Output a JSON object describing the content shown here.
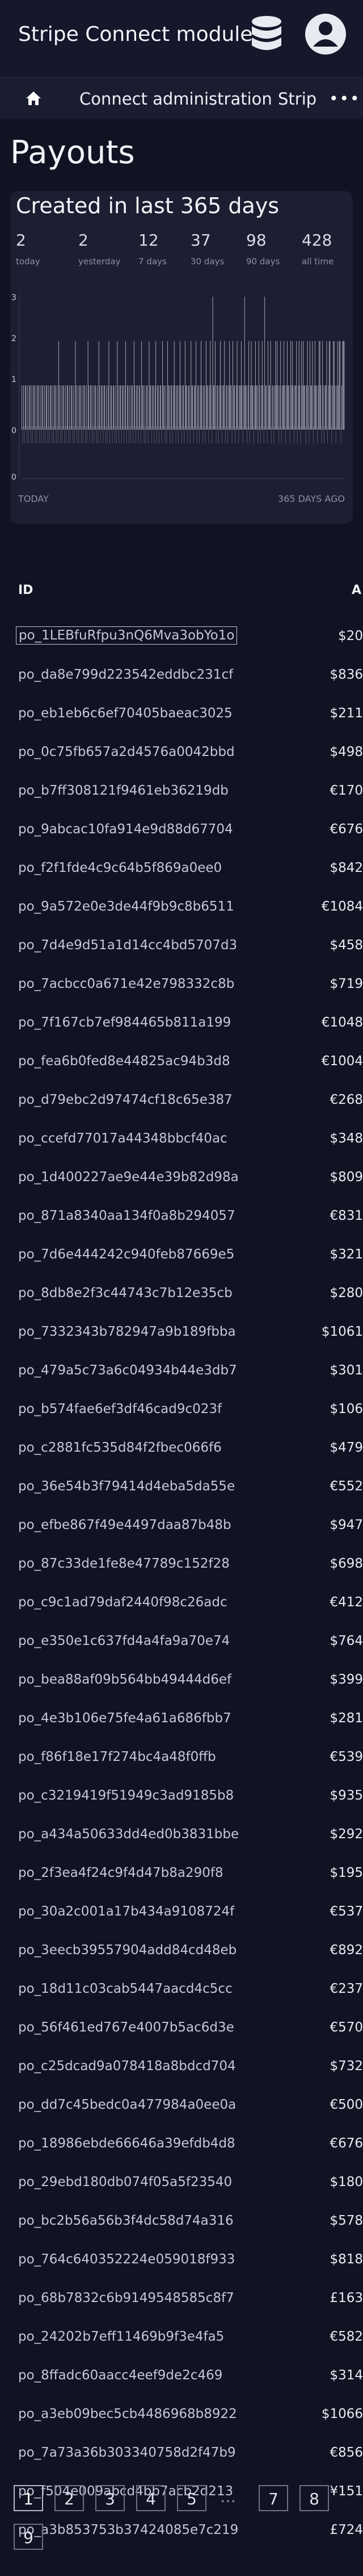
{
  "app": {
    "title": "Stripe Connect module"
  },
  "nav": {
    "items": [
      "Connect administration",
      "Strip"
    ]
  },
  "page": {
    "title": "Payouts"
  },
  "stats": {
    "heading": "Created in last 365 days",
    "counters": [
      {
        "value": "2",
        "label": "today"
      },
      {
        "value": "2",
        "label": "yesterday"
      },
      {
        "value": "12",
        "label": "7 days"
      },
      {
        "value": "37",
        "label": "30 days"
      },
      {
        "value": "98",
        "label": "90 days"
      },
      {
        "value": "428",
        "label": "all time"
      }
    ],
    "y_ticks": [
      "3",
      "2",
      "1",
      "0",
      "0"
    ],
    "left_label": "TODAY",
    "right_label": "365 DAYS AGO"
  },
  "chart_data": {
    "type": "bar",
    "title": "Created in last 365 days",
    "xlabel": "",
    "ylabel": "",
    "x_range": [
      "TODAY",
      "365 DAYS AGO"
    ],
    "ylim": [
      0,
      3
    ],
    "y_ticks": [
      3,
      2,
      1,
      0,
      0
    ],
    "values": [
      2,
      2,
      2,
      1,
      0,
      2,
      2,
      1,
      2,
      1,
      0,
      1,
      2,
      2,
      1,
      0,
      1,
      2,
      2,
      1,
      0,
      2,
      1,
      1,
      0,
      1,
      2,
      0,
      1,
      2,
      2,
      1,
      0,
      1,
      1,
      2,
      1,
      0,
      2,
      1,
      1,
      2,
      0,
      1,
      2,
      1,
      0,
      1,
      1,
      2,
      1,
      2,
      0,
      1,
      2,
      1,
      0,
      2,
      1,
      1,
      0,
      1,
      2,
      1,
      2,
      0,
      1,
      1,
      2,
      1,
      0,
      1,
      2,
      1,
      1,
      0,
      2,
      1,
      0,
      1,
      2,
      1,
      2,
      1,
      0,
      1,
      1,
      0,
      2,
      1,
      1,
      2,
      0,
      1,
      1,
      3,
      0,
      1,
      2,
      1,
      0,
      1,
      2,
      0,
      1,
      1,
      2,
      1,
      0,
      1,
      1,
      2,
      1,
      0,
      2,
      1,
      0,
      1,
      1,
      3,
      1,
      0,
      1,
      2,
      1,
      1,
      0,
      1,
      2,
      1,
      0,
      1,
      1,
      2,
      0,
      1,
      1,
      2,
      1,
      0,
      1,
      1,
      0,
      2,
      1,
      1,
      0,
      1,
      2,
      1,
      0,
      1,
      1,
      0,
      2,
      1,
      1,
      3,
      0,
      1,
      2,
      1,
      0,
      1,
      1,
      2,
      0,
      1,
      1,
      0,
      1,
      2,
      1,
      0,
      1,
      1,
      0,
      2,
      1,
      1,
      0,
      1,
      1,
      2,
      0,
      1,
      1,
      0,
      1,
      1,
      2,
      0,
      1,
      1,
      0,
      1,
      2,
      1,
      0,
      1,
      1,
      0,
      1,
      2,
      1,
      0,
      1,
      1,
      0,
      1,
      1,
      2,
      0,
      1,
      0,
      1,
      1,
      2,
      0,
      1,
      1,
      0,
      1,
      1,
      0,
      2,
      1,
      0,
      1,
      1,
      0,
      1,
      1,
      2,
      0,
      1,
      1,
      0,
      1,
      0,
      1,
      1,
      2,
      0,
      1,
      1,
      0,
      1,
      1,
      0,
      1,
      2,
      0,
      1,
      1,
      0,
      1,
      0,
      1,
      1,
      0,
      2,
      1,
      0,
      1,
      1,
      0,
      1,
      1,
      0,
      1,
      2,
      0,
      1,
      0,
      1,
      1,
      0,
      1,
      1,
      0,
      2,
      1,
      0,
      1,
      0,
      1,
      1,
      0,
      1,
      1,
      0,
      1,
      2,
      0,
      1,
      0,
      1,
      1,
      0,
      1,
      0,
      1,
      1,
      0,
      1,
      2,
      0,
      1,
      0,
      1,
      1,
      0,
      1,
      0,
      1,
      1,
      0,
      1,
      0,
      1,
      2,
      0,
      1,
      0,
      1,
      1,
      0,
      1,
      0,
      1,
      1,
      0,
      1,
      0,
      1,
      1,
      0,
      1,
      0,
      1,
      2,
      0,
      1,
      0,
      1,
      1,
      0,
      1,
      0,
      1,
      1,
      0,
      1,
      0,
      1,
      1,
      0,
      1,
      0,
      1,
      1,
      0,
      1,
      0,
      1,
      1,
      0,
      1,
      0,
      1,
      1,
      0,
      1,
      0,
      1,
      1,
      0,
      1,
      0,
      1,
      1,
      0,
      1,
      0,
      1
    ]
  },
  "table": {
    "headers": {
      "id": "ID",
      "amount": "A"
    },
    "rows": [
      {
        "id": "po_1LEBfuRfpu3nQ6Mva3obYo1o",
        "amount": "$20"
      },
      {
        "id": "po_da8e799d223542eddbc231cf",
        "amount": "$836"
      },
      {
        "id": "po_eb1eb6c6ef70405baeac3025",
        "amount": "$211"
      },
      {
        "id": "po_0c75fb657a2d4576a0042bbd",
        "amount": "$498"
      },
      {
        "id": "po_b7ff308121f9461eb36219db",
        "amount": "€170"
      },
      {
        "id": "po_9abcac10fa914e9d88d67704",
        "amount": "€676"
      },
      {
        "id": "po_f2f1fde4c9c64b5f869a0ee0",
        "amount": "$842"
      },
      {
        "id": "po_9a572e0e3de44f9b9c8b6511",
        "amount": "€1084"
      },
      {
        "id": "po_7d4e9d51a1d14cc4bd5707d3",
        "amount": "$458"
      },
      {
        "id": "po_7acbcc0a671e42e798332c8b",
        "amount": "$719"
      },
      {
        "id": "po_7f167cb7ef984465b811a199",
        "amount": "€1048"
      },
      {
        "id": "po_fea6b0fed8e44825ac94b3d8",
        "amount": "€1004"
      },
      {
        "id": "po_d79ebc2d97474cf18c65e387",
        "amount": "€268"
      },
      {
        "id": "po_ccefd77017a44348bbcf40ac",
        "amount": "$348"
      },
      {
        "id": "po_1d400227ae9e44e39b82d98a",
        "amount": "$809"
      },
      {
        "id": "po_871a8340aa134f0a8b294057",
        "amount": "€831"
      },
      {
        "id": "po_7d6e444242c940feb87669e5",
        "amount": "$321"
      },
      {
        "id": "po_8db8e2f3c44743c7b12e35cb",
        "amount": "$280"
      },
      {
        "id": "po_7332343b782947a9b189fbba",
        "amount": "$1061"
      },
      {
        "id": "po_479a5c73a6c04934b44e3db7",
        "amount": "$301"
      },
      {
        "id": "po_b574fae6ef3df46cad9c023f",
        "amount": "$106"
      },
      {
        "id": "po_c2881fc535d84f2fbec066f6",
        "amount": "$479"
      },
      {
        "id": "po_36e54b3f79414d4eba5da55e",
        "amount": "€552"
      },
      {
        "id": "po_efbe867f49e4497daa87b48b",
        "amount": "$947"
      },
      {
        "id": "po_87c33de1fe8e47789c152f28",
        "amount": "$698"
      },
      {
        "id": "po_c9c1ad79daf2440f98c26adc",
        "amount": "€412"
      },
      {
        "id": "po_e350e1c637fd4a4fa9a70e74",
        "amount": "$764"
      },
      {
        "id": "po_bea88af09b564bb49444d6ef",
        "amount": "$399"
      },
      {
        "id": "po_4e3b106e75fe4a61a686fbb7",
        "amount": "$281"
      },
      {
        "id": "po_f86f18e17f274bc4a48f0ffb",
        "amount": "€539"
      },
      {
        "id": "po_c3219419f51949c3ad9185b8",
        "amount": "$935"
      },
      {
        "id": "po_a434a50633dd4ed0b3831bbe",
        "amount": "$292"
      },
      {
        "id": "po_2f3ea4f24c9f4d47b8a290f8",
        "amount": "$195"
      },
      {
        "id": "po_30a2c001a17b434a9108724f",
        "amount": "€537"
      },
      {
        "id": "po_3eecb39557904add84cd48eb",
        "amount": "€892"
      },
      {
        "id": "po_18d11c03cab5447aacd4c5cc",
        "amount": "€237"
      },
      {
        "id": "po_56f461ed767e4007b5ac6d3e",
        "amount": "€570"
      },
      {
        "id": "po_c25dcad9a078418a8bdcd704",
        "amount": "$732"
      },
      {
        "id": "po_dd7c45bedc0a477984a0ee0a",
        "amount": "€500"
      },
      {
        "id": "po_18986ebde66646a39efdb4d8",
        "amount": "€676"
      },
      {
        "id": "po_29ebd180db074f05a5f23540",
        "amount": "$180"
      },
      {
        "id": "po_bc2b56a56b3f4dc58d74a316",
        "amount": "$578"
      },
      {
        "id": "po_764c640352224e059018f933",
        "amount": "$818"
      },
      {
        "id": "po_68b7832c6b9149548585c8f7",
        "amount": "£163"
      },
      {
        "id": "po_24202b7eff11469b9f3e4fa5",
        "amount": "€582"
      },
      {
        "id": "po_8ffadc60aacc4eef9de2c469",
        "amount": "$314"
      },
      {
        "id": "po_a3eb09bec5cb4486968b8922",
        "amount": "$1066"
      },
      {
        "id": "po_7a73a36b303340758d2f47b9",
        "amount": "€856"
      },
      {
        "id": "po_f504e009abcd4bb7acb2d213",
        "amount": "¥151"
      },
      {
        "id": "po_a3b853753b37424085e7c219",
        "amount": "£724"
      }
    ]
  },
  "pagination": {
    "pages": [
      "1",
      "2",
      "3",
      "4",
      "5"
    ],
    "ellipsis": "…",
    "tail": [
      "7",
      "8",
      "9"
    ],
    "current": "1"
  },
  "colors": {
    "background": "#111322",
    "bar": "#c9ccd9",
    "card": "#1c1f31"
  }
}
